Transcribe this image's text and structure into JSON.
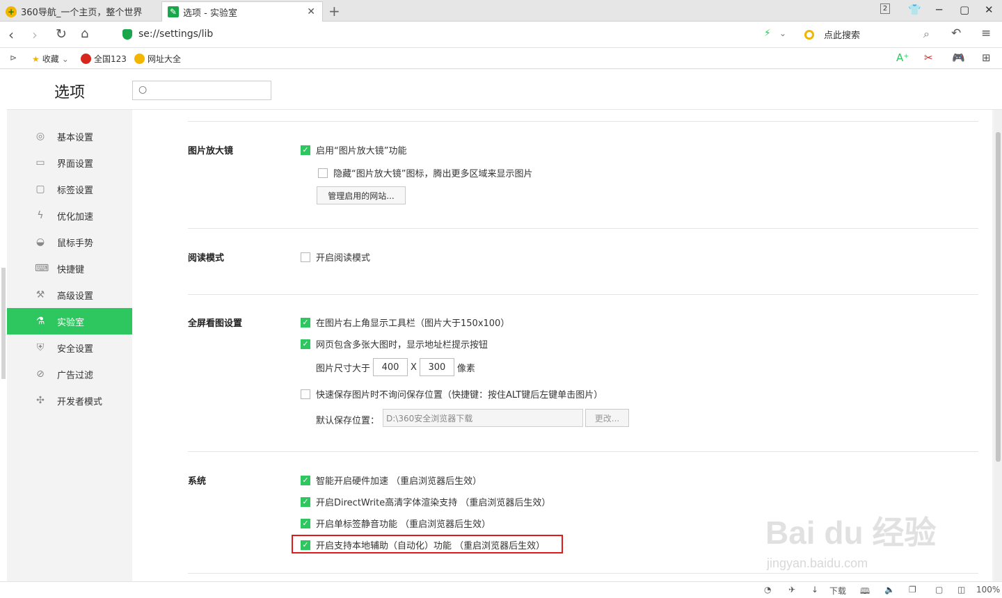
{
  "tabs": [
    {
      "title": "360导航_一个主页，整个世界"
    },
    {
      "title": "选项 - 实验室"
    }
  ],
  "window": {
    "tab_count": "2"
  },
  "address": {
    "url": "se://settings/lib",
    "search_placeholder": "点此搜索"
  },
  "bookmarks": [
    {
      "label": "收藏"
    },
    {
      "label": "全国123"
    },
    {
      "label": "网址大全"
    }
  ],
  "header": {
    "title": "选项"
  },
  "sidebar": {
    "items": [
      {
        "label": "基本设置",
        "icon": "gear-icon"
      },
      {
        "label": "界面设置",
        "icon": "window-icon"
      },
      {
        "label": "标签设置",
        "icon": "tab-icon"
      },
      {
        "label": "优化加速",
        "icon": "lightning-icon"
      },
      {
        "label": "鼠标手势",
        "icon": "mouse-icon"
      },
      {
        "label": "快捷键",
        "icon": "keyboard-icon"
      },
      {
        "label": "高级设置",
        "icon": "wrench-icon"
      },
      {
        "label": "实验室",
        "icon": "flask-icon"
      },
      {
        "label": "安全设置",
        "icon": "shield-icon"
      },
      {
        "label": "广告过滤",
        "icon": "block-icon"
      },
      {
        "label": "开发者模式",
        "icon": "puzzle-icon"
      }
    ],
    "active": "实验室"
  },
  "sections": {
    "magnifier": {
      "title": "图片放大镜",
      "enable_label": "启用“图片放大镜”功能",
      "hide_label": "隐藏“图片放大镜”图标，腾出更多区域来显示图片",
      "manage_button": "管理启用的网站..."
    },
    "reading": {
      "title": "阅读模式",
      "enable_label": "开启阅读模式"
    },
    "fullscreen": {
      "title": "全屏看图设置",
      "toolbar_label": "在图片右上角显示工具栏（图片大于150x100）",
      "addrbar_label": "网页包含多张大图时，显示地址栏提示按钮",
      "size_prefix": "图片尺寸大于",
      "width": "400",
      "size_x": "X",
      "height": "300",
      "size_unit": "像素",
      "quicksave_label": "快速保存图片时不询问保存位置（快捷键：按住ALT键后左键单击图片）",
      "default_path_label": "默认保存位置：",
      "default_path": "D:\\360安全浏览器下载",
      "change_button": "更改..."
    },
    "system": {
      "title": "系统",
      "hw_accel": "智能开启硬件加速 （重启浏览器后生效）",
      "directwrite": "开启DirectWrite高清字体渲染支持 （重启浏览器后生效）",
      "tab_mute": "开启单标签静音功能 （重启浏览器后生效）",
      "automation": "开启支持本地辅助（自动化）功能 （重启浏览器后生效）"
    }
  },
  "statusbar": {
    "download": "下载",
    "zoom": "100%"
  },
  "watermark": {
    "brand": "Bai du 经验",
    "url": "jingyan.baidu.com"
  }
}
